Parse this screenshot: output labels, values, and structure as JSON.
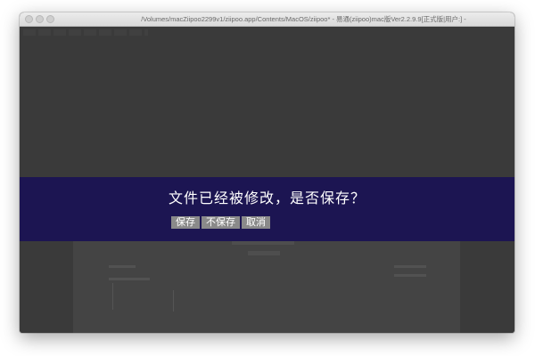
{
  "window": {
    "title": "/Volumes/macZiipoo2299v1/ziipoo.app/Contents/MacOS/ziipoo* - 易通(ziipoo)mac版Ver2.2.9.9[正式版|用户:]  -"
  },
  "dialog": {
    "message": "文件已经被修改，是否保存？",
    "buttons": {
      "save": "保存",
      "dont_save": "不保存",
      "cancel": "取消"
    },
    "colors": {
      "background": "#1c1552",
      "button": "#8a8a8a",
      "text": "#ffffff"
    }
  },
  "colors": {
    "overlay": "#3a3a3a"
  }
}
